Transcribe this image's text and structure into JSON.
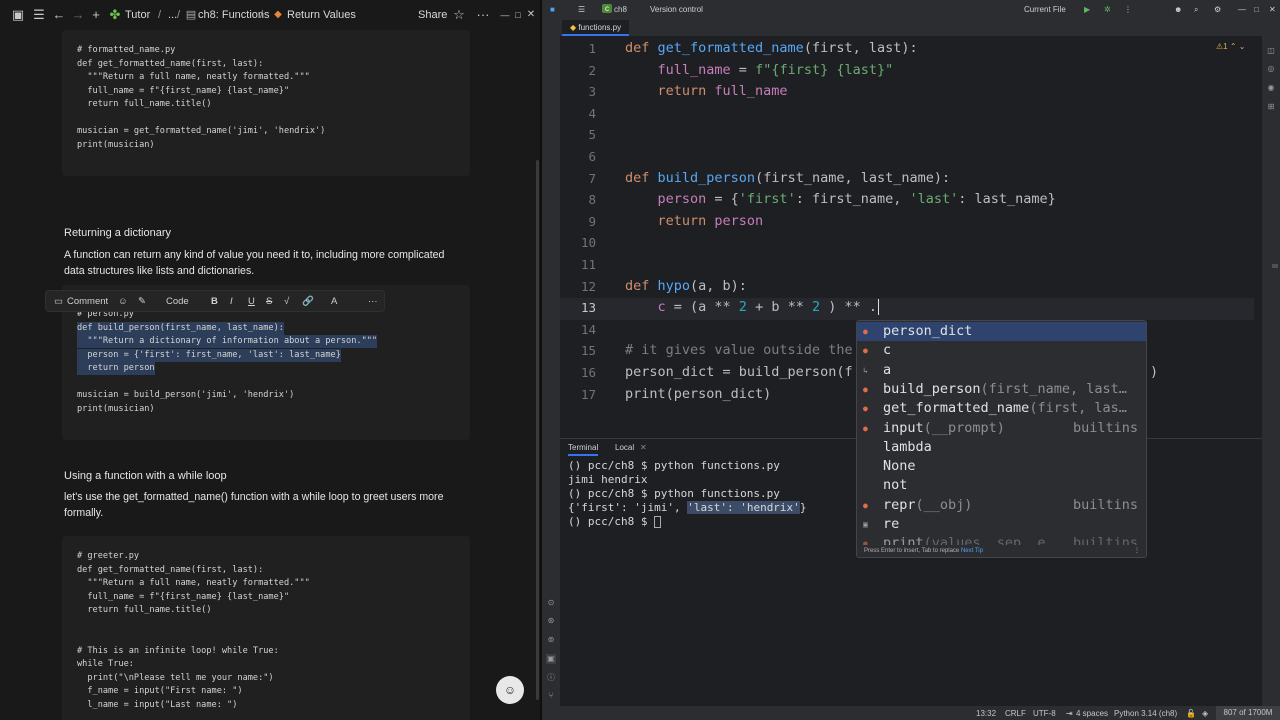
{
  "left_app": {
    "toolbar": {
      "breadcrumb_root": "Tutor",
      "breadcrumb_ellipsis": "...",
      "breadcrumb_mid": "ch8: Functions",
      "breadcrumb_page": "Return Values",
      "share_label": "Share"
    },
    "block1": [
      "# formatted_name.py",
      "def get_formatted_name(first, last):",
      "  \"\"\"Return a full name, neatly formatted.\"\"\"",
      "  full_name = f\"{first_name} {last_name}\"",
      "  return full_name.title()",
      "",
      "musician = get_formatted_name('jimi', 'hendrix')",
      "print(musician)"
    ],
    "heading_dict": "Returning a dictionary",
    "para_dict_1": "A function can return any kind of value you need it to, including more complicated",
    "para_dict_2": "data structures like lists and dictionaries.",
    "format_toolbar": {
      "comment": "Comment",
      "code": "Code",
      "bold": "B",
      "italic": "I",
      "underline": "U",
      "strike": "S",
      "text_color": "A",
      "more": "···"
    },
    "block2": [
      "# person.py",
      "def build_person(first_name, last_name):",
      "  \"\"\"Return a dictionary of information about a person.\"\"\"",
      "  person = {'first': first_name, 'last': last_name}",
      "  return person",
      "",
      "musician = build_person('jimi', 'hendrix')",
      "print(musician)"
    ],
    "heading_while": "Using a function with a while loop",
    "para_while_1": "let's use the get_formatted_name() function with a while loop to greet users more",
    "para_while_2": "formally.",
    "block3": [
      "# greeter.py",
      "def get_formatted_name(first, last):",
      "  \"\"\"Return a full name, neatly formatted.\"\"\"",
      "  full_name = f\"{first_name} {last_name}\"",
      "  return full_name.title()",
      "",
      "",
      "# This is an infinite loop! while True:",
      "while True:",
      "  print(\"\\nPlease tell me your name:\")",
      "  f_name = input(\"First name: \")",
      "  l_name = input(\"Last name: \")"
    ]
  },
  "ide": {
    "project": "ch8",
    "vcs": "Version control",
    "run_config": "Current File",
    "tab_name": "functions.py",
    "warnings": "1",
    "line_numbers": [
      "1",
      "2",
      "3",
      "4",
      "5",
      "6",
      "7",
      "8",
      "9",
      "10",
      "11",
      "12",
      "13",
      "14",
      "15",
      "16",
      "17"
    ],
    "code": {
      "l1_def": "def ",
      "l1_fn": "get_formatted_name",
      "l1_rest": "(first, last):",
      "l2_var": "    full_name",
      "l2_eq": " = ",
      "l2_str": "f\"{first} {last}\"",
      "l3_kw": "    return ",
      "l3_var": "full_name",
      "l7_def": "def ",
      "l7_fn": "build_person",
      "l7_rest": "(first_name, last_name):",
      "l8_var": "    person",
      "l8_a": " = {",
      "l8_s1": "'first'",
      "l8_b": ": first_name, ",
      "l8_s2": "'last'",
      "l8_c": ": last_name}",
      "l9_kw": "    return ",
      "l9_var": "person",
      "l12_def": "def ",
      "l12_fn": "hypo",
      "l12_rest": "(a, b):",
      "l13_var": "    c",
      "l13_a": " = (a ** ",
      "l13_n1": "2",
      "l13_b": " + b ** ",
      "l13_n2": "2",
      "l13_c": " ) ** .",
      "l15": "# it gives value outside the",
      "l16_a": "person_dict = build_person(",
      "l16_b": "f",
      "l16_tail": ")",
      "l17": "print(person_dict)"
    },
    "completion": {
      "items": [
        {
          "name": "person_dict",
          "type": ""
        },
        {
          "name": "c",
          "type": ""
        },
        {
          "name": "a",
          "type": ""
        },
        {
          "name": "build_person",
          "params": "(first_name, last…",
          "type": ""
        },
        {
          "name": "get_formatted_name",
          "params": "(first, las…",
          "type": ""
        },
        {
          "name": "input",
          "params": "(__prompt)",
          "type": "builtins"
        },
        {
          "name": "lambda",
          "type": ""
        },
        {
          "name": "None",
          "type": ""
        },
        {
          "name": "not",
          "type": ""
        },
        {
          "name": "repr",
          "params": "(__obj)",
          "type": "builtins"
        },
        {
          "name": "re",
          "type": ""
        },
        {
          "name": "print",
          "params": "(values, sep, e…",
          "type": "builtins"
        }
      ],
      "footer": "Press Enter to insert, Tab to replace",
      "next_tip": "Next Tip"
    },
    "terminal": {
      "tab_terminal": "Terminal",
      "tab_local": "Local",
      "l1": "() pcc/ch8 $ python functions.py",
      "l2": "jimi hendrix",
      "l3": "() pcc/ch8 $ python functions.py",
      "l4a": "{'first': 'jimi', ",
      "l4sel": "'last': 'hendrix'",
      "l4b": "}",
      "l5": "() pcc/ch8 $ "
    },
    "status": {
      "position": "13:32",
      "line_sep": "CRLF",
      "encoding": "UTF-8",
      "indent": "4 spaces",
      "interpreter": "Python 3.14 (ch8)",
      "memory": "807 of 1700M"
    }
  }
}
